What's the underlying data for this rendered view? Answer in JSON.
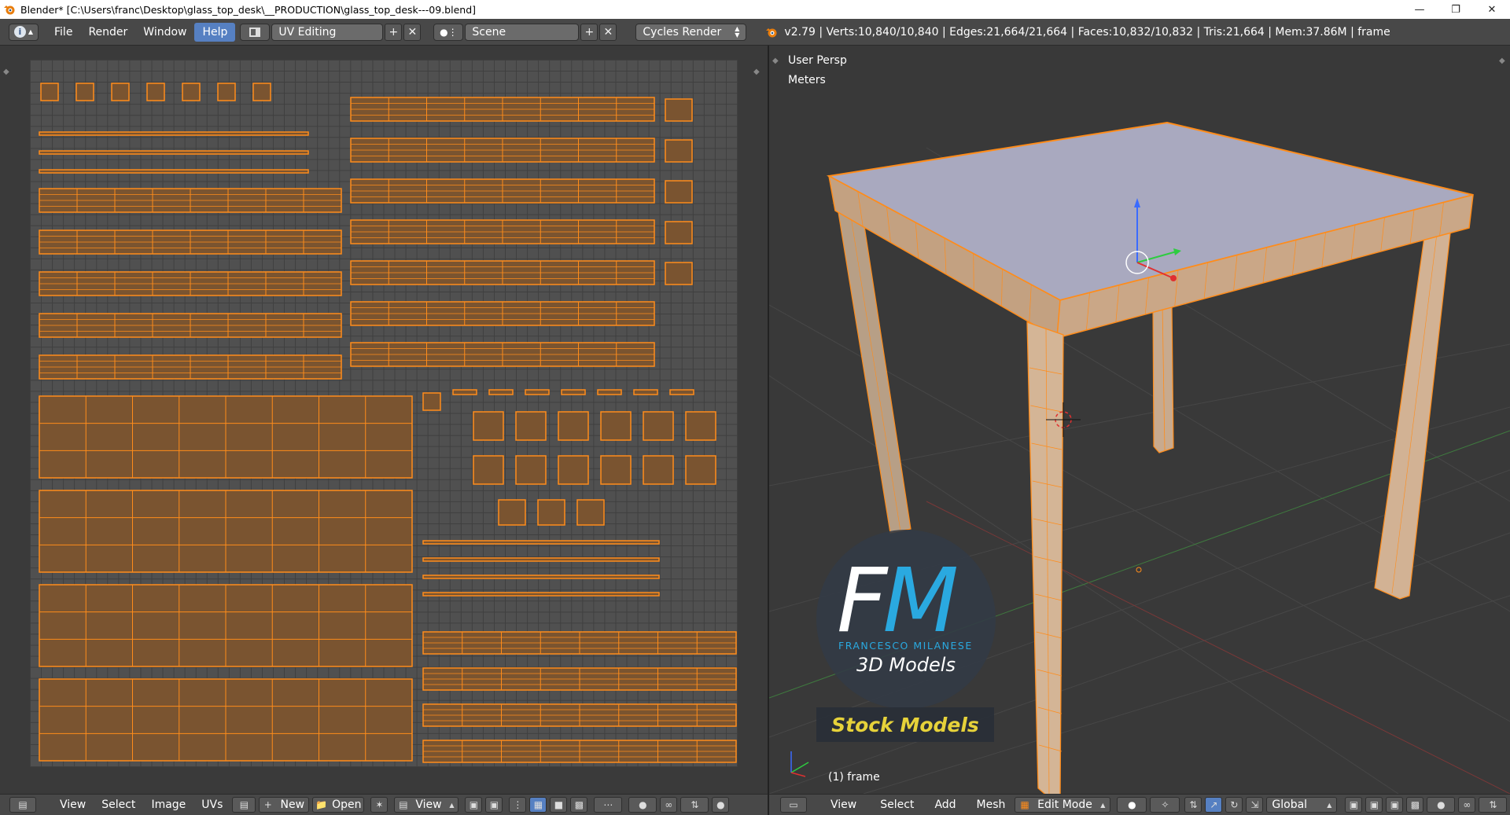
{
  "window": {
    "title": "Blender* [C:\\Users\\franc\\Desktop\\glass_top_desk\\__PRODUCTION\\glass_top_desk---09.blend]",
    "controls": [
      "minimize-icon",
      "restore-icon",
      "close-icon"
    ]
  },
  "info_header": {
    "menus": [
      "File",
      "Render",
      "Window",
      "Help"
    ],
    "active_menu": "Help",
    "screen_layout": "UV Editing",
    "scene": "Scene",
    "render_engine": "Cycles Render",
    "stats": "v2.79 | Verts:10,840/10,840 | Edges:21,664/21,664 | Faces:10,832/10,832 | Tris:21,664 | Mem:37.86M | frame"
  },
  "viewport": {
    "view_label": "User Persp",
    "units_label": "Meters",
    "object_label": "(1) frame"
  },
  "watermark": {
    "letter_f": "F",
    "letter_m": "M",
    "name": "FRANCESCO MILANESE",
    "subtitle": "3D Models",
    "stock": "Stock Models",
    "colors": {
      "accent": "#2aa9e0",
      "stock": "#e6d23a"
    }
  },
  "uv_footer": {
    "menus": [
      "View",
      "Select",
      "Image",
      "UVs"
    ],
    "new_label": "New",
    "open_label": "Open",
    "view_label": "View"
  },
  "vp_footer": {
    "menus": [
      "View",
      "Select",
      "Add",
      "Mesh"
    ],
    "mode": "Edit Mode",
    "orientation": "Global"
  },
  "colors": {
    "selection": "#ff8c1a",
    "uv_face": "#7a5430",
    "active_menu": "#5680c2",
    "glass_top": "#a9a9bf"
  }
}
